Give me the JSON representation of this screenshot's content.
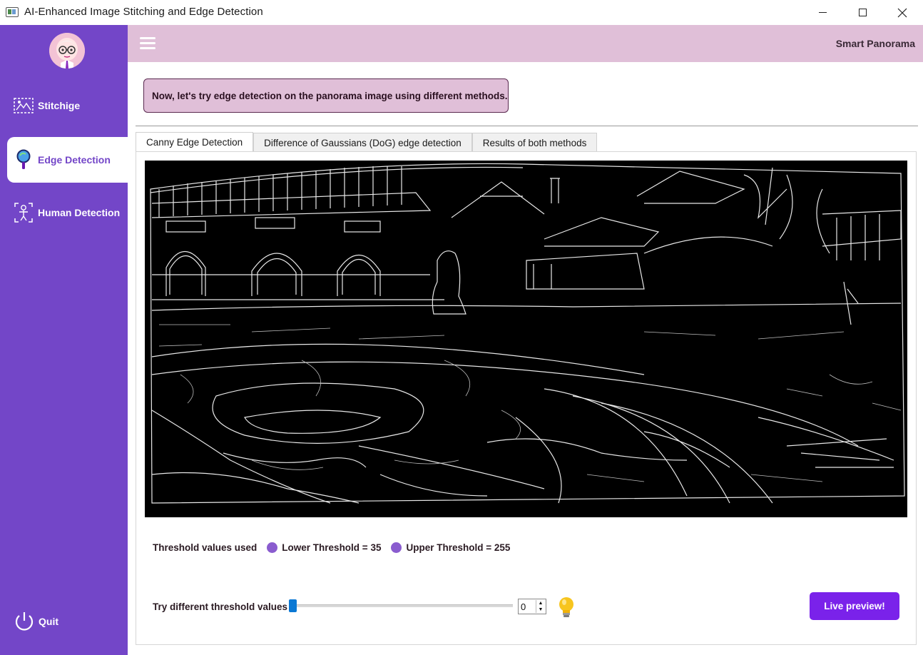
{
  "window": {
    "title": "AI-Enhanced  Image Stitching and Edge Detection"
  },
  "header": {
    "brand": "Smart Panorama"
  },
  "sidebar": {
    "items": [
      {
        "label": "Stitchige",
        "icon": "stitch-icon"
      },
      {
        "label": "Edge Detection",
        "icon": "magnifier-icon",
        "active": true
      },
      {
        "label": "Human Detection",
        "icon": "person-scan-icon"
      }
    ],
    "quit_label": "Quit"
  },
  "main": {
    "message": "Now, let's try edge detection on the panorama image using different methods.",
    "tabs": [
      {
        "label": "Canny Edge Detection",
        "active": true
      },
      {
        "label": "Difference of Gaussians (DoG) edge detection"
      },
      {
        "label": "Results of both methods"
      }
    ],
    "threshold": {
      "caption": "Threshold values used",
      "lower": "Lower Threshold = 35",
      "upper": "Upper Threshold = 255"
    },
    "try": {
      "label": "Try different threshold values",
      "slider_value": 0,
      "spin_value": "0"
    },
    "live_preview_label": "Live preview!"
  },
  "colors": {
    "sidebar": "#7346c8",
    "topbar": "#e0bfd8",
    "accent": "#7a22ea",
    "slider": "#0a78d4"
  }
}
